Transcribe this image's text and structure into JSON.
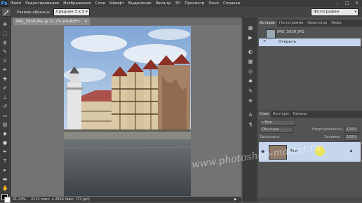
{
  "app": {
    "logo": "Ps"
  },
  "menu": [
    "Файл",
    "Редактирование",
    "Изображение",
    "Слои",
    "Шрифт",
    "Выделение",
    "Фильтр",
    "3D",
    "Просмотр",
    "Окно",
    "Справка"
  ],
  "window_controls": {
    "minimize": "–",
    "maximize": "□",
    "close": "✕"
  },
  "options_bar": {
    "sample_size_label": "Размер образца:",
    "sample_size_value": "Среднее 3 x 3",
    "workspace": "Фотография"
  },
  "document": {
    "tab_title": "IMG_3930.JPG @ 21,2% (RGB/8*)",
    "close": "×"
  },
  "status_bar": {
    "zoom": "21,24%",
    "doc_info": "2112 пикс. x 2816 пикс. (72 ppi)",
    "arrow": "▶"
  },
  "history_panel": {
    "tabs": [
      "История",
      "Гистограмма",
      "Навигатор",
      "Инфо"
    ],
    "snapshot": "IMG_3930.JPG",
    "items": [
      "Открыть"
    ]
  },
  "layers_panel": {
    "tabs": [
      "Слои",
      "Контуры",
      "Каналы"
    ],
    "filter": "Вид",
    "blend_mode": "Обычные",
    "opacity_label": "Непрозрачность:",
    "opacity_value": "100%",
    "lock_label": "Закрепить:",
    "fill_label": "Заливка:",
    "fill_value": "100%",
    "layers": [
      {
        "name": "Фон"
      }
    ]
  },
  "watermark": "www.photoshop-master.ru"
}
